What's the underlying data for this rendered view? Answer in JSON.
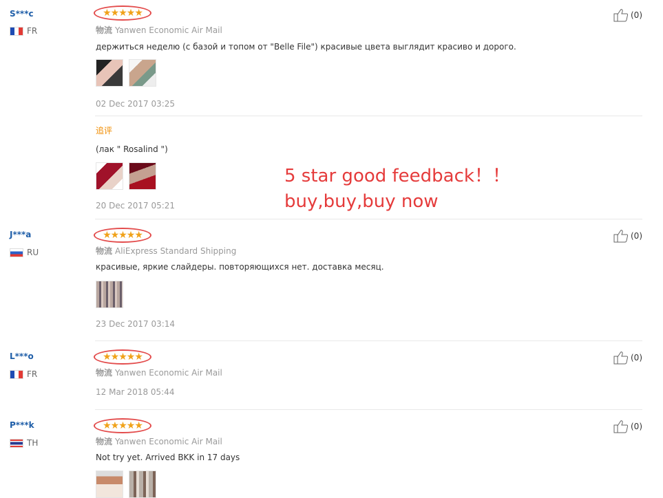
{
  "promo": {
    "line1": "5 star good feedback！！",
    "line2": "buy,buy,buy now"
  },
  "stars_glyph": "★★★★★",
  "shipping_prefix": "物流",
  "reviews": [
    {
      "user": "S***c",
      "country": "FR",
      "flag": "fr",
      "shipping": "Yanwen Economic Air Mail",
      "comment": "держиться неделю (с базой и топом от \"Belle File\") красивые цвета выглядит красиво и дорого.",
      "date": "02 Dec 2017 03:25",
      "likes": "(0)",
      "additional": {
        "label": "追评",
        "comment": "(лак \" Rosalind \")",
        "date": "20 Dec 2017 05:21"
      }
    },
    {
      "user": "J***a",
      "country": "RU",
      "flag": "ru",
      "shipping": "AliExpress Standard Shipping",
      "comment": "красивые, яркие слайдеры. повторяющихся нет. доставка месяц.",
      "date": "23 Dec 2017 03:14",
      "likes": "(0)"
    },
    {
      "user": "L***o",
      "country": "FR",
      "flag": "fr",
      "shipping": "Yanwen Economic Air Mail",
      "comment": "",
      "date": "12 Mar 2018 05:44",
      "likes": "(0)"
    },
    {
      "user": "P***k",
      "country": "TH",
      "flag": "th",
      "shipping": "Yanwen Economic Air Mail",
      "comment": "Not try yet. Arrived BKK in 17 days",
      "date": "",
      "likes": "(0)"
    }
  ],
  "colors": {
    "user_link": "#1f5ea8",
    "star": "#f0a21a",
    "highlight_ellipse": "#e34b4b",
    "promo_text": "#e53b3b",
    "additional_label": "#f08c00"
  }
}
